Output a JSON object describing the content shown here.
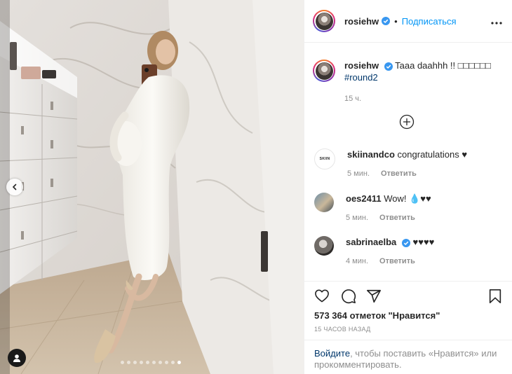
{
  "header": {
    "username": "rosiehw",
    "separator": "•",
    "follow_label": "Подписаться"
  },
  "caption": {
    "username": "rosiehw",
    "text": "Taaa daahhh !! □□□□□□",
    "hashtag": "#round2",
    "time": "15 ч."
  },
  "comments": [
    {
      "username": "skiinandco",
      "text": "congratulations ♥",
      "time": "5 мин.",
      "reply": "Ответить",
      "avatar_text": "SKIIN"
    },
    {
      "username": "oes2411",
      "text": "Wow! 💧♥♥",
      "time": "5 мин.",
      "reply": "Ответить"
    },
    {
      "username": "sabrinaelba",
      "text": "♥♥♥♥",
      "time": "4 мин.",
      "reply": "Ответить"
    }
  ],
  "likes_text": "573 364 отметок \"Нравится\"",
  "posted_ago": "15 ЧАСОВ НАЗАД",
  "login_prompt": {
    "link": "Войдите",
    "rest": ", чтобы поставить «Нравится» или прокомментировать."
  },
  "carousel": {
    "slides": 10,
    "active_index": 9
  },
  "colors": {
    "accent": "#0095f6",
    "hashtag": "#00376b",
    "muted": "#8e8e8e",
    "text": "#262626"
  },
  "icons": {
    "like": "heart-icon",
    "comment": "comment-icon",
    "share": "share-icon",
    "save": "bookmark-icon",
    "more": "more-icon",
    "load_more": "plus-circle-icon",
    "prev": "chevron-left-icon",
    "tags": "user-tag-icon"
  }
}
